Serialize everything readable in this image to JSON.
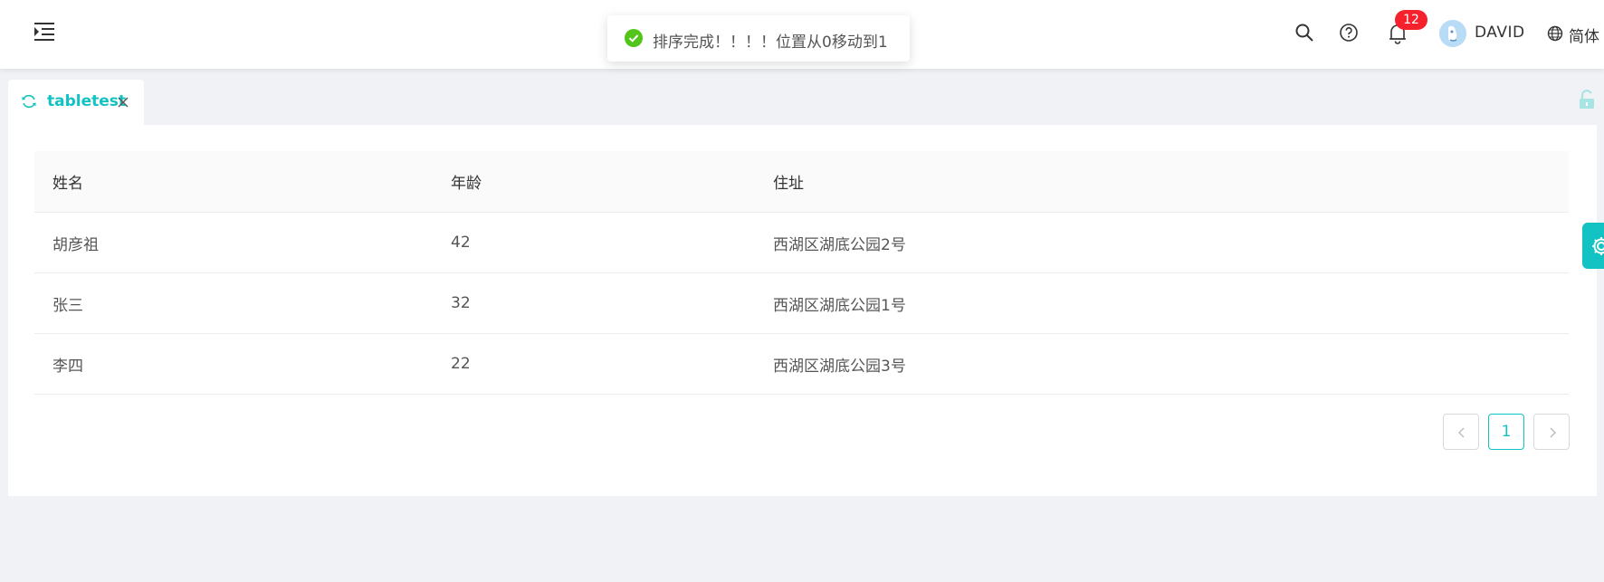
{
  "header": {
    "user_name": "DAVID",
    "notification_count": "12",
    "language_label": "简体"
  },
  "toast": {
    "message": "排序完成！！！！位置从0移动到1"
  },
  "tabs": [
    {
      "label": "tabletest"
    }
  ],
  "table": {
    "columns": [
      "姓名",
      "年龄",
      "住址"
    ],
    "rows": [
      {
        "name": "胡彦祖",
        "age": "42",
        "address": "西湖区湖底公园2号"
      },
      {
        "name": "张三",
        "age": "32",
        "address": "西湖区湖底公园1号"
      },
      {
        "name": "李四",
        "age": "22",
        "address": "西湖区湖底公园3号"
      }
    ]
  },
  "pagination": {
    "current_page": "1"
  },
  "colors": {
    "accent": "#13c2c2",
    "badge": "#f5222d",
    "success": "#52c41a"
  },
  "icons": {
    "menu": "menu-unfold-icon",
    "search": "search-icon",
    "help": "question-circle-icon",
    "notifications": "bell-icon",
    "language": "globe-icon",
    "tab_reload": "reload-icon",
    "tab_close": "close-icon",
    "lock": "unlock-icon",
    "settings": "gear-icon",
    "toast_status": "check-circle-icon"
  }
}
